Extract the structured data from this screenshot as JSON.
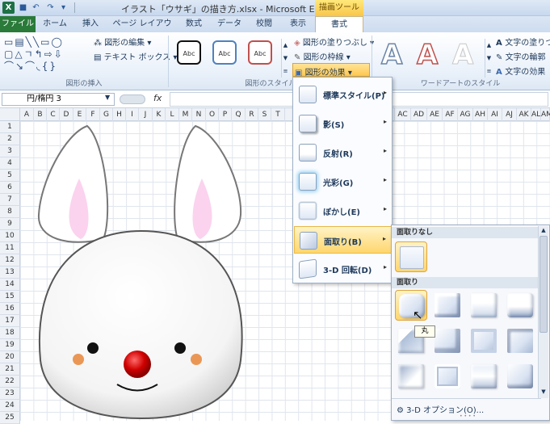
{
  "window": {
    "title": "イラスト「ウサギ」の描き方.xlsx - Microsoft Excel",
    "context_group": "描画ツール",
    "app_icon": "X"
  },
  "tabs": [
    "ファイル",
    "ホーム",
    "挿入",
    "ページ レイアウト",
    "数式",
    "データ",
    "校閲",
    "表示",
    "書式"
  ],
  "ribbon": {
    "shape_insert": {
      "label": "図形の挿入",
      "edit_shape": "図形の編集",
      "text_box": "テキスト ボックス"
    },
    "shape_styles": {
      "label": "図形のスタイル",
      "fill": "図形の塗りつぶし",
      "outline": "図形の枠線",
      "effects": "図形の効果",
      "style_sample": "Abc"
    },
    "wordart": {
      "label": "ワードアートのスタイル",
      "text_fill": "文字の塗りつ",
      "text_outline": "文字の輪郭",
      "text_effects": "文字の効果",
      "letter": "A"
    }
  },
  "formula_bar": {
    "name_box": "円/楕円 3",
    "fx": "fx"
  },
  "columns": [
    "A",
    "B",
    "C",
    "D",
    "E",
    "F",
    "G",
    "H",
    "I",
    "J",
    "K",
    "L",
    "M",
    "N",
    "O",
    "P",
    "Q",
    "R",
    "S",
    "T",
    "AB",
    "AC",
    "AD",
    "AE",
    "AF",
    "AG",
    "AH",
    "AI",
    "AJ",
    "AK",
    "AL",
    "AM"
  ],
  "rows": [
    "1",
    "2",
    "3",
    "4",
    "5",
    "6",
    "7",
    "8",
    "9",
    "10",
    "11",
    "12",
    "13",
    "14",
    "15",
    "16",
    "17",
    "18",
    "19",
    "20",
    "21",
    "22",
    "23",
    "24",
    "25"
  ],
  "effects_menu": [
    {
      "label": "標準スタイル(P)",
      "active": false
    },
    {
      "label": "影(S)",
      "active": false
    },
    {
      "label": "反射(R)",
      "active": false
    },
    {
      "label": "光彩(G)",
      "active": false
    },
    {
      "label": "ぼかし(E)",
      "active": false
    },
    {
      "label": "面取り(B)",
      "active": true
    },
    {
      "label": "3-D 回転(D)",
      "active": false
    }
  ],
  "bevel_submenu": {
    "no_bevel_header": "面取りなし",
    "bevel_header": "面取り",
    "options_link": "3-D オプション(O)...",
    "tooltip": "丸"
  },
  "colors": {
    "accent_tab_group": "#f8c64a",
    "file_tab": "#2a7a3a",
    "nose": "#cc0000",
    "cheek": "#e8863a"
  }
}
